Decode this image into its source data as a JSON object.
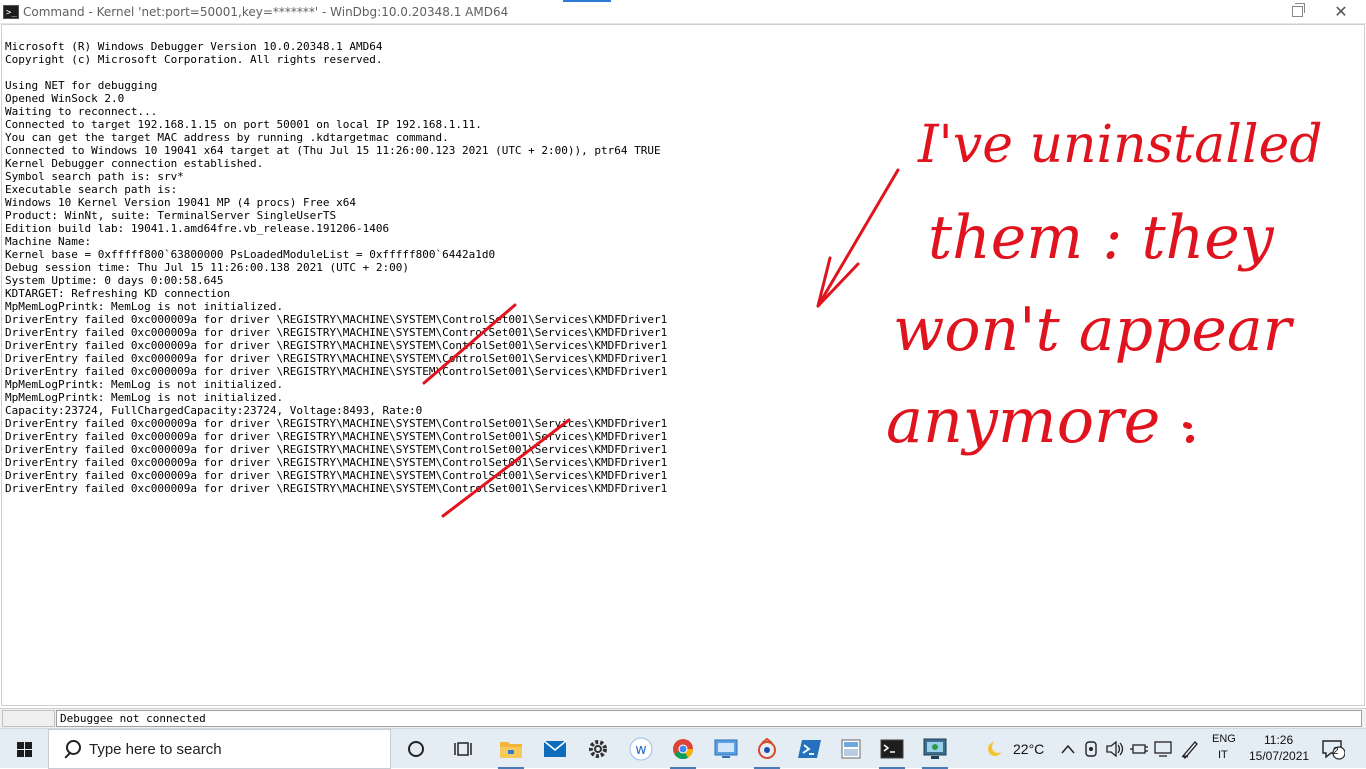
{
  "window": {
    "title": "Command - Kernel 'net:port=50001,key=*******' - WinDbg:10.0.20348.1 AMD64",
    "close_glyph": "✕"
  },
  "log_lines": [
    "Microsoft (R) Windows Debugger Version 10.0.20348.1 AMD64",
    "Copyright (c) Microsoft Corporation. All rights reserved.",
    "",
    "Using NET for debugging",
    "Opened WinSock 2.0",
    "Waiting to reconnect...",
    "Connected to target 192.168.1.15 on port 50001 on local IP 192.168.1.11.",
    "You can get the target MAC address by running .kdtargetmac command.",
    "Connected to Windows 10 19041 x64 target at (Thu Jul 15 11:26:00.123 2021 (UTC + 2:00)), ptr64 TRUE",
    "Kernel Debugger connection established.",
    "Symbol search path is: srv*",
    "Executable search path is:",
    "Windows 10 Kernel Version 19041 MP (4 procs) Free x64",
    "Product: WinNt, suite: TerminalServer SingleUserTS",
    "Edition build lab: 19041.1.amd64fre.vb_release.191206-1406",
    "Machine Name:",
    "Kernel base = 0xfffff800`63800000 PsLoadedModuleList = 0xfffff800`6442a1d0",
    "Debug session time: Thu Jul 15 11:26:00.138 2021 (UTC + 2:00)",
    "System Uptime: 0 days 0:00:58.645",
    "KDTARGET: Refreshing KD connection",
    "MpMemLogPrintk: MemLog is not initialized.",
    "DriverEntry failed 0xc000009a for driver \\REGISTRY\\MACHINE\\SYSTEM\\ControlSet001\\Services\\KMDFDriver1",
    "DriverEntry failed 0xc000009a for driver \\REGISTRY\\MACHINE\\SYSTEM\\ControlSet001\\Services\\KMDFDriver1",
    "DriverEntry failed 0xc000009a for driver \\REGISTRY\\MACHINE\\SYSTEM\\ControlSet001\\Services\\KMDFDriver1",
    "DriverEntry failed 0xc000009a for driver \\REGISTRY\\MACHINE\\SYSTEM\\ControlSet001\\Services\\KMDFDriver1",
    "DriverEntry failed 0xc000009a for driver \\REGISTRY\\MACHINE\\SYSTEM\\ControlSet001\\Services\\KMDFDriver1",
    "MpMemLogPrintk: MemLog is not initialized.",
    "MpMemLogPrintk: MemLog is not initialized.",
    "Capacity:23724, FullChargedCapacity:23724, Voltage:8493, Rate:0",
    "DriverEntry failed 0xc000009a for driver \\REGISTRY\\MACHINE\\SYSTEM\\ControlSet001\\Services\\KMDFDriver1",
    "DriverEntry failed 0xc000009a for driver \\REGISTRY\\MACHINE\\SYSTEM\\ControlSet001\\Services\\KMDFDriver1",
    "DriverEntry failed 0xc000009a for driver \\REGISTRY\\MACHINE\\SYSTEM\\ControlSet001\\Services\\KMDFDriver1",
    "DriverEntry failed 0xc000009a for driver \\REGISTRY\\MACHINE\\SYSTEM\\ControlSet001\\Services\\KMDFDriver1",
    "DriverEntry failed 0xc000009a for driver \\REGISTRY\\MACHINE\\SYSTEM\\ControlSet001\\Services\\KMDFDriver1",
    "DriverEntry failed 0xc000009a for driver \\REGISTRY\\MACHINE\\SYSTEM\\ControlSet001\\Services\\KMDFDriver1"
  ],
  "annotation": {
    "lines": [
      "I've uninstalled",
      "them : they",
      "won't appear",
      "anymore ."
    ],
    "color": "#e0141e"
  },
  "statusbar": {
    "text": "Debuggee not connected"
  },
  "taskbar": {
    "search_placeholder": "Type here to search",
    "icons": [
      "task-view-icon",
      "timeline-icon",
      "file-explorer-icon",
      "mail-icon",
      "settings-icon",
      "word-app-icon",
      "chrome-icon",
      "remote-desktop-icon",
      "windbg-icon",
      "powershell-icon",
      "image-viewer-icon",
      "terminal-icon",
      "debug-tool-icon"
    ],
    "weather": "22°C",
    "lang_top": "ENG",
    "lang_bottom": "IT",
    "time": "11:26",
    "date": "15/07/2021",
    "notification_count": "2"
  }
}
